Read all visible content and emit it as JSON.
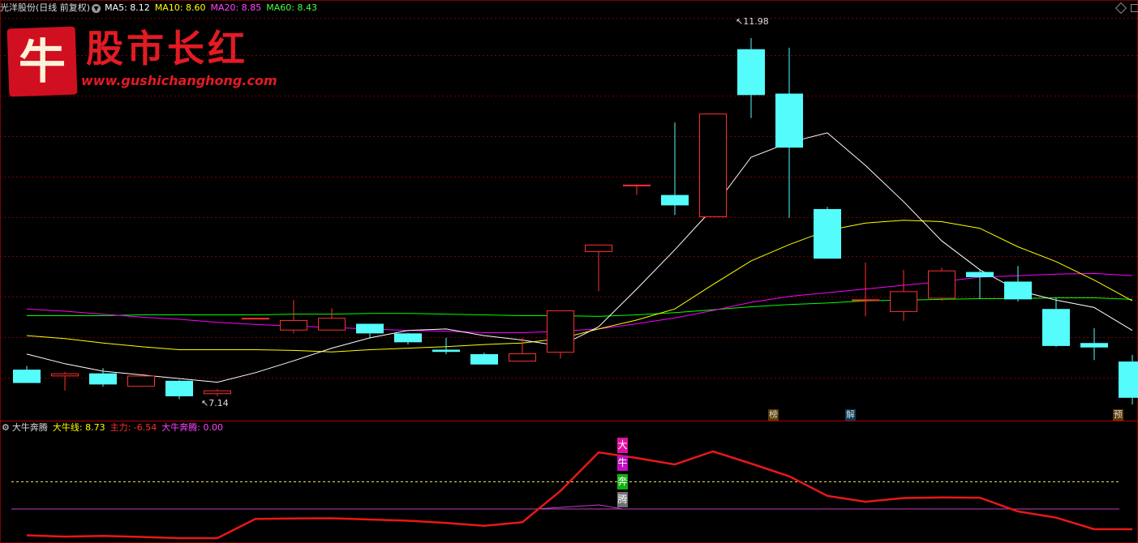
{
  "header": {
    "stock_title": "光洋股份(日线 前复权)",
    "ma5_label": "MA5: 8.12",
    "ma10_label": "MA10: 8.60",
    "ma20_label": "MA20: 8.85",
    "ma60_label": "MA60: 8.43",
    "dropdown_icon": "chevron-down-icon"
  },
  "logo": {
    "badge_char": "牛",
    "title": "股市长红",
    "url": "www.gushichanghong.com"
  },
  "price_labels": {
    "high": "11.98",
    "low": "7.14"
  },
  "event_tags": [
    {
      "text": "榜",
      "color": "#e0a060"
    },
    {
      "text": "解",
      "color": "#66e0ff"
    },
    {
      "text": "预",
      "color": "#e0a060"
    }
  ],
  "indicator": {
    "title": "大牛奔腾",
    "line_label": "大牛线: 8.73",
    "main_force_label": "主力: -6.54",
    "signal_label": "大牛奔腾: 0.00"
  },
  "signal_tag": [
    "大",
    "牛",
    "奔",
    "腾"
  ],
  "colors": {
    "up": "#ff3030",
    "down": "#54fcfc",
    "ma5": "#ffffff",
    "ma10": "#ffff00",
    "ma20": "#ff00ff",
    "ma60": "#00ff00",
    "grid": "#7a0000"
  },
  "chart_data": {
    "type": "candlestick",
    "title": "光洋股份(日线 前复权)",
    "candles": [
      {
        "open": 7.5,
        "close": 7.32,
        "high": 7.55,
        "low": 7.32
      },
      {
        "open": 7.41,
        "close": 7.45,
        "high": 7.47,
        "low": 7.22
      },
      {
        "open": 7.45,
        "close": 7.3,
        "high": 7.52,
        "low": 7.27
      },
      {
        "open": 7.27,
        "close": 7.42,
        "high": 7.43,
        "low": 7.27
      },
      {
        "open": 7.35,
        "close": 7.14,
        "high": 7.36,
        "low": 7.1
      },
      {
        "open": 7.17,
        "close": 7.22,
        "high": 7.24,
        "low": 7.14
      },
      {
        "open": 8.2,
        "close": 8.2,
        "high": 8.2,
        "low": 8.2
      },
      {
        "open": 8.03,
        "close": 8.17,
        "high": 8.44,
        "low": 7.99
      },
      {
        "open": 8.03,
        "close": 8.2,
        "high": 8.33,
        "low": 8.03
      },
      {
        "open": 8.12,
        "close": 7.99,
        "high": 8.12,
        "low": 7.92
      },
      {
        "open": 7.99,
        "close": 7.87,
        "high": 8.0,
        "low": 7.84
      },
      {
        "open": 7.77,
        "close": 7.74,
        "high": 7.93,
        "low": 7.71
      },
      {
        "open": 7.71,
        "close": 7.57,
        "high": 7.73,
        "low": 7.57
      },
      {
        "open": 7.61,
        "close": 7.72,
        "high": 7.93,
        "low": 7.61
      },
      {
        "open": 7.73,
        "close": 8.3,
        "high": 8.3,
        "low": 7.65
      },
      {
        "open": 9.09,
        "close": 9.19,
        "high": 9.19,
        "low": 8.56
      },
      {
        "open": 10.0,
        "close": 10.0,
        "high": 10.0,
        "low": 9.86
      },
      {
        "open": 9.86,
        "close": 9.72,
        "high": 10.84,
        "low": 9.59
      },
      {
        "open": 9.56,
        "close": 10.96,
        "high": 10.96,
        "low": 9.56
      },
      {
        "open": 11.83,
        "close": 11.21,
        "high": 11.98,
        "low": 10.9
      },
      {
        "open": 11.23,
        "close": 10.5,
        "high": 11.85,
        "low": 9.55
      },
      {
        "open": 9.67,
        "close": 9.0,
        "high": 9.7,
        "low": 9.0
      },
      {
        "open": 8.45,
        "close": 8.45,
        "high": 8.95,
        "low": 8.22
      },
      {
        "open": 8.28,
        "close": 8.56,
        "high": 8.85,
        "low": 8.16
      },
      {
        "open": 8.46,
        "close": 8.84,
        "high": 8.88,
        "low": 8.43
      },
      {
        "open": 8.82,
        "close": 8.75,
        "high": 8.85,
        "low": 8.46
      },
      {
        "open": 8.69,
        "close": 8.45,
        "high": 8.9,
        "low": 8.42
      },
      {
        "open": 8.32,
        "close": 7.82,
        "high": 8.47,
        "low": 7.81
      },
      {
        "open": 7.86,
        "close": 7.8,
        "high": 8.06,
        "low": 7.63
      },
      {
        "open": 7.61,
        "close": 7.12,
        "high": 7.7,
        "low": 7.03
      }
    ],
    "ma5": [
      7.71,
      7.58,
      7.48,
      7.43,
      7.38,
      7.33,
      7.46,
      7.62,
      7.79,
      7.93,
      8.03,
      8.05,
      7.96,
      7.9,
      7.82,
      8.08,
      8.59,
      9.12,
      9.68,
      10.37,
      10.57,
      10.7,
      10.26,
      9.77,
      9.24,
      8.85,
      8.57,
      8.44,
      8.34,
      8.03
    ],
    "ma10": [
      7.96,
      7.92,
      7.86,
      7.81,
      7.77,
      7.77,
      7.77,
      7.76,
      7.74,
      7.77,
      7.79,
      7.81,
      7.84,
      7.86,
      7.92,
      8.05,
      8.17,
      8.32,
      8.65,
      8.97,
      9.19,
      9.38,
      9.48,
      9.52,
      9.5,
      9.41,
      9.16,
      8.96,
      8.71,
      8.43
    ],
    "ma20": [
      8.32,
      8.29,
      8.25,
      8.21,
      8.18,
      8.14,
      8.11,
      8.09,
      8.07,
      8.05,
      8.03,
      8.02,
      8.0,
      8.0,
      8.02,
      8.05,
      8.12,
      8.2,
      8.3,
      8.41,
      8.49,
      8.54,
      8.59,
      8.64,
      8.69,
      8.75,
      8.77,
      8.79,
      8.8,
      8.77
    ],
    "ma60": [
      8.23,
      8.23,
      8.23,
      8.24,
      8.24,
      8.24,
      8.24,
      8.25,
      8.25,
      8.26,
      8.26,
      8.25,
      8.24,
      8.23,
      8.23,
      8.22,
      8.24,
      8.27,
      8.31,
      8.35,
      8.38,
      8.4,
      8.43,
      8.44,
      8.45,
      8.46,
      8.46,
      8.47,
      8.47,
      8.45
    ],
    "indicator_series": {
      "name": "主力",
      "values": [
        -8.5,
        -8.9,
        -8.7,
        -9.0,
        -9.4,
        -9.4,
        -3.2,
        -3.1,
        -3.0,
        -3.4,
        -3.8,
        -4.5,
        -5.4,
        -4.3,
        5.8,
        18.2,
        16.4,
        14.3,
        18.5,
        14.6,
        10.5,
        4.2,
        2.3,
        3.5,
        3.7,
        3.6,
        -0.8,
        -2.8,
        -6.54,
        -6.54
      ],
      "big_bull_line": 8.73,
      "signal_value": 0.0
    }
  }
}
